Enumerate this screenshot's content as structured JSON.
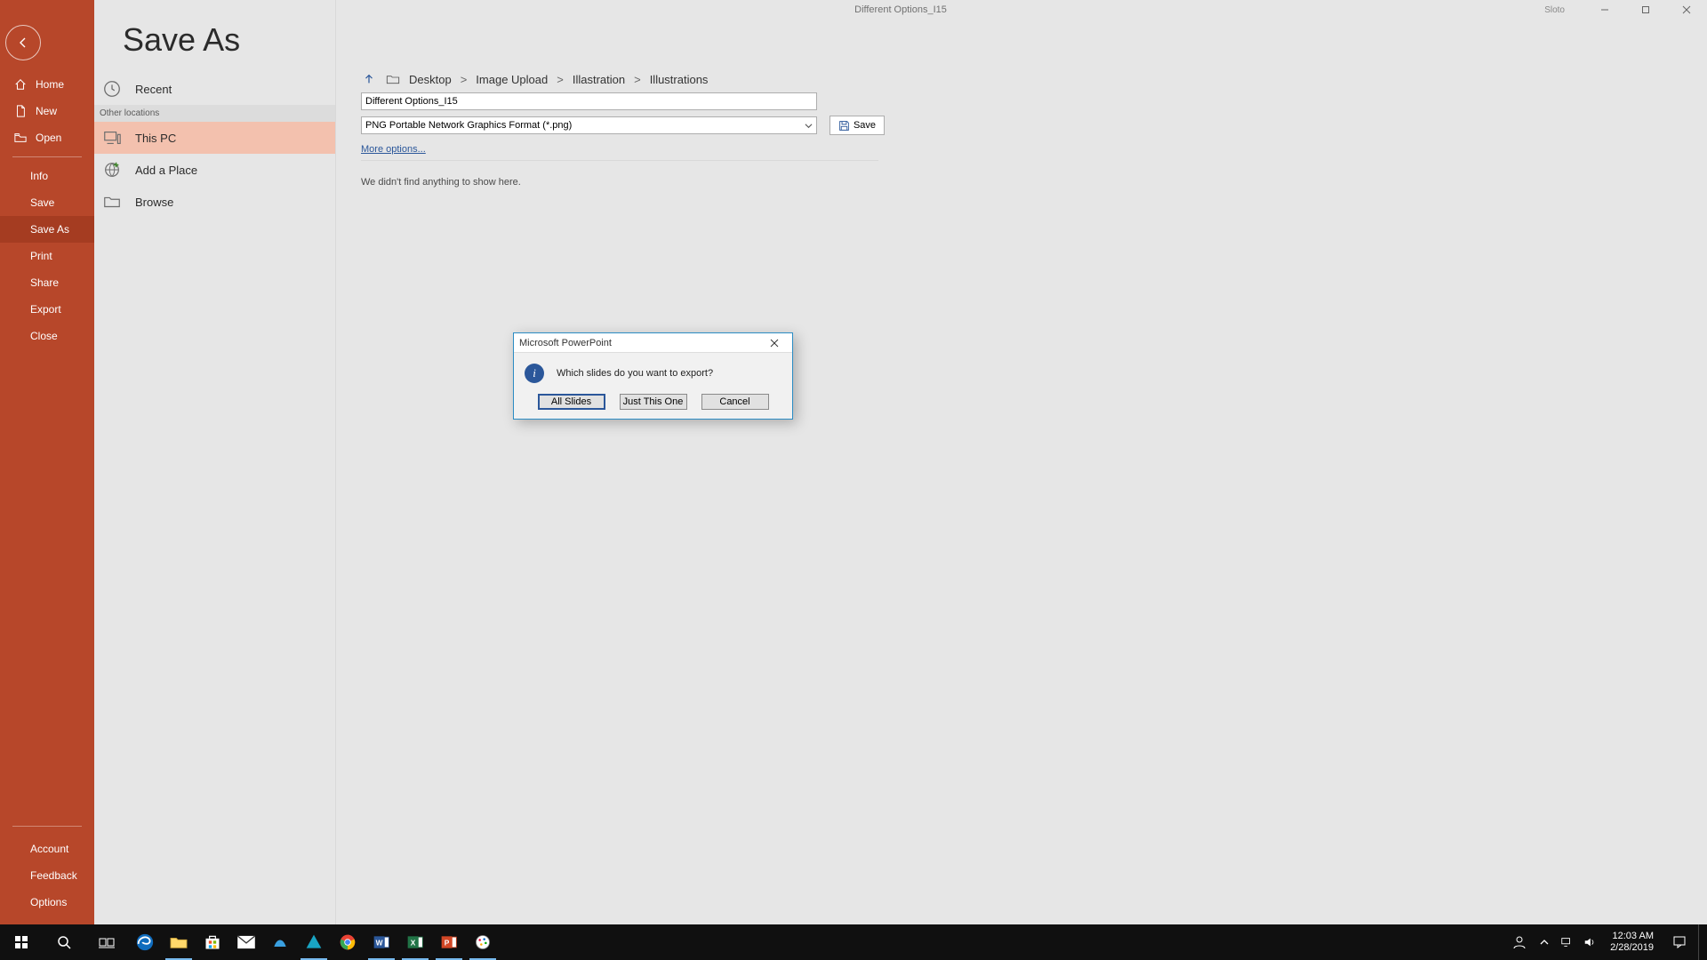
{
  "app": {
    "doc_title": "Different Options_I15",
    "user": "Sloto"
  },
  "sidebar": {
    "home": "Home",
    "new": "New",
    "open": "Open",
    "items": [
      "Info",
      "Save",
      "Save As",
      "Print",
      "Share",
      "Export",
      "Close"
    ],
    "active_index": 2,
    "bottom": [
      "Account",
      "Feedback",
      "Options"
    ]
  },
  "page": {
    "title": "Save As",
    "locations_header": "Other locations",
    "recent": "Recent",
    "this_pc": "This PC",
    "add_place": "Add a Place",
    "browse": "Browse",
    "selected": "this_pc"
  },
  "save_panel": {
    "breadcrumb": [
      "Desktop",
      "Image Upload",
      "Illastration",
      "Illustrations"
    ],
    "filename": "Different Options_I15",
    "format": "PNG Portable Network Graphics Format (*.png)",
    "save_btn": "Save",
    "more_link": "More options...",
    "empty_msg": "We didn't find anything to show here."
  },
  "dialog": {
    "title": "Microsoft PowerPoint",
    "message": "Which slides do you want to export?",
    "buttons": {
      "all": "All Slides",
      "one": "Just This One",
      "cancel": "Cancel"
    }
  },
  "taskbar": {
    "time": "12:03 AM",
    "date": "2/28/2019"
  }
}
